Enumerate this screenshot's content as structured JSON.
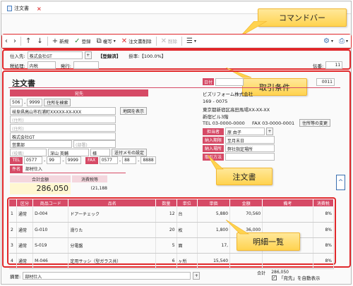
{
  "tab": {
    "title": "注文書",
    "close": "×"
  },
  "callouts": {
    "command_bar": "コマンドバー",
    "transaction": "取引条件",
    "order": "注文書",
    "detail": "明細一覧"
  },
  "toolbar": {
    "new": "新規",
    "register": "登録",
    "copy": "複写",
    "delete": "注文書削除",
    "cut": "削除"
  },
  "conditions": {
    "supplier_label": "仕入先:",
    "supplier": "株式会社GT",
    "register_label": "【登録済】",
    "rate_label": "掛率:【100.0%】",
    "tax_label": "税処理:",
    "tax_value": "内税",
    "issue_label": "発行:",
    "count_label": "伝番:",
    "count_value": "11"
  },
  "order": {
    "title": "注文書",
    "destination_header": "宛先",
    "zip": "506",
    "zip2": "9999",
    "addr_btn": "住所を検索",
    "address": "岐阜県高山市石浦町XXXXX-XX-XXX",
    "map_btn": "地図を表示",
    "addr2_ph": "(住所)",
    "addr3_ph": "(住所)",
    "company": "株式会社GT",
    "dept": "営業部",
    "dept_ph": "(部署)",
    "person_ph": "(役職)",
    "person": "深山 英輔",
    "honor": "様",
    "memo_btn": "送付メモの設定",
    "tel_label": "TEL",
    "tel": [
      "0577",
      "99",
      "9999"
    ],
    "fax_label": "FAX",
    "fax": [
      "0577",
      "88",
      "8888"
    ],
    "subject_label": "件名",
    "subject": "部材仕入",
    "total_label": "合計金額",
    "tax_header": "消費税等",
    "total": "286,050",
    "tax_amt": "(21,188"
  },
  "sender": {
    "date_label": "日付",
    "no_value": "0011",
    "company": "ビズリフォーム株式会社",
    "zip": "169 - 0075",
    "addr": "東京都新宿区高田馬場XX-XX-XX",
    "bldg": "新宿ビル3階",
    "tel": "TEL 03-0000-0000",
    "fax": "FAX 03-0000-0001",
    "addr_change_btn": "住所等の変更",
    "rep_label": "担当者",
    "rep": "原 由子",
    "deadline_label": "納入期限",
    "deadline": "至月末日",
    "place_label": "納入場所",
    "place": "弊社指定場所",
    "payment_label": "取引方法"
  },
  "detail": {
    "headers": [
      "区分",
      "商品コード",
      "品名",
      "数量",
      "単位",
      "単価",
      "金額",
      "備考",
      "消費税"
    ],
    "rows": [
      {
        "n": "1",
        "kind": "通常",
        "code": "D-004",
        "name": "ドアーチェック",
        "qty": "12",
        "unit": "台",
        "price": "5,880",
        "amount": "70,560",
        "note": "",
        "tax": "8%"
      },
      {
        "n": "2",
        "kind": "通常",
        "code": "G-010",
        "name": "滑りた",
        "qty": "20",
        "unit": "枚",
        "price": "1,800",
        "amount": "36,000",
        "note": "",
        "tax": "8%"
      },
      {
        "n": "3",
        "kind": "通常",
        "code": "S-019",
        "name": "分電盤",
        "qty": "5",
        "unit": "面",
        "price": "17,",
        "amount": "",
        "note": "",
        "tax": "8%"
      },
      {
        "n": "4",
        "kind": "通常",
        "code": "M-046",
        "name": "定用サッシ（型ガラス共）",
        "qty": "6",
        "unit": "ヶ所",
        "price": "15,540",
        "amount": "",
        "note": "",
        "tax": "8%"
      }
    ],
    "total_label": "合計",
    "total": "286,050"
  },
  "footer": {
    "summary_label": "摘要:",
    "summary": "部材仕入",
    "auto_label": "「宛先」を自動表示"
  },
  "colors": {
    "accent": "#d64a66",
    "callout": "#ffd34f",
    "highlight": "#e0282b"
  }
}
